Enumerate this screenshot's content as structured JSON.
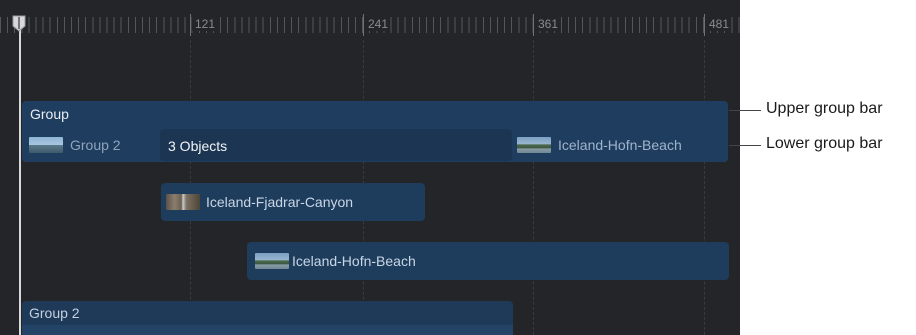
{
  "ruler": {
    "ticks": [
      "121",
      "241",
      "361",
      "481"
    ]
  },
  "playhead": {
    "icon": "playhead-marker-icon"
  },
  "timeline": {
    "upper_group": {
      "label": "Group"
    },
    "lower_group": {
      "group2_label": "Group 2",
      "objects_label": "3 Objects",
      "beach_label": "Iceland-Hofn-Beach"
    },
    "clips": {
      "canyon": {
        "label": "Iceland-Fjadrar-Canyon"
      },
      "beach": {
        "label": "Iceland-Hofn-Beach"
      }
    },
    "group2": {
      "label": "Group 2"
    }
  },
  "callouts": {
    "upper": "Upper group bar",
    "lower": "Lower group bar"
  }
}
